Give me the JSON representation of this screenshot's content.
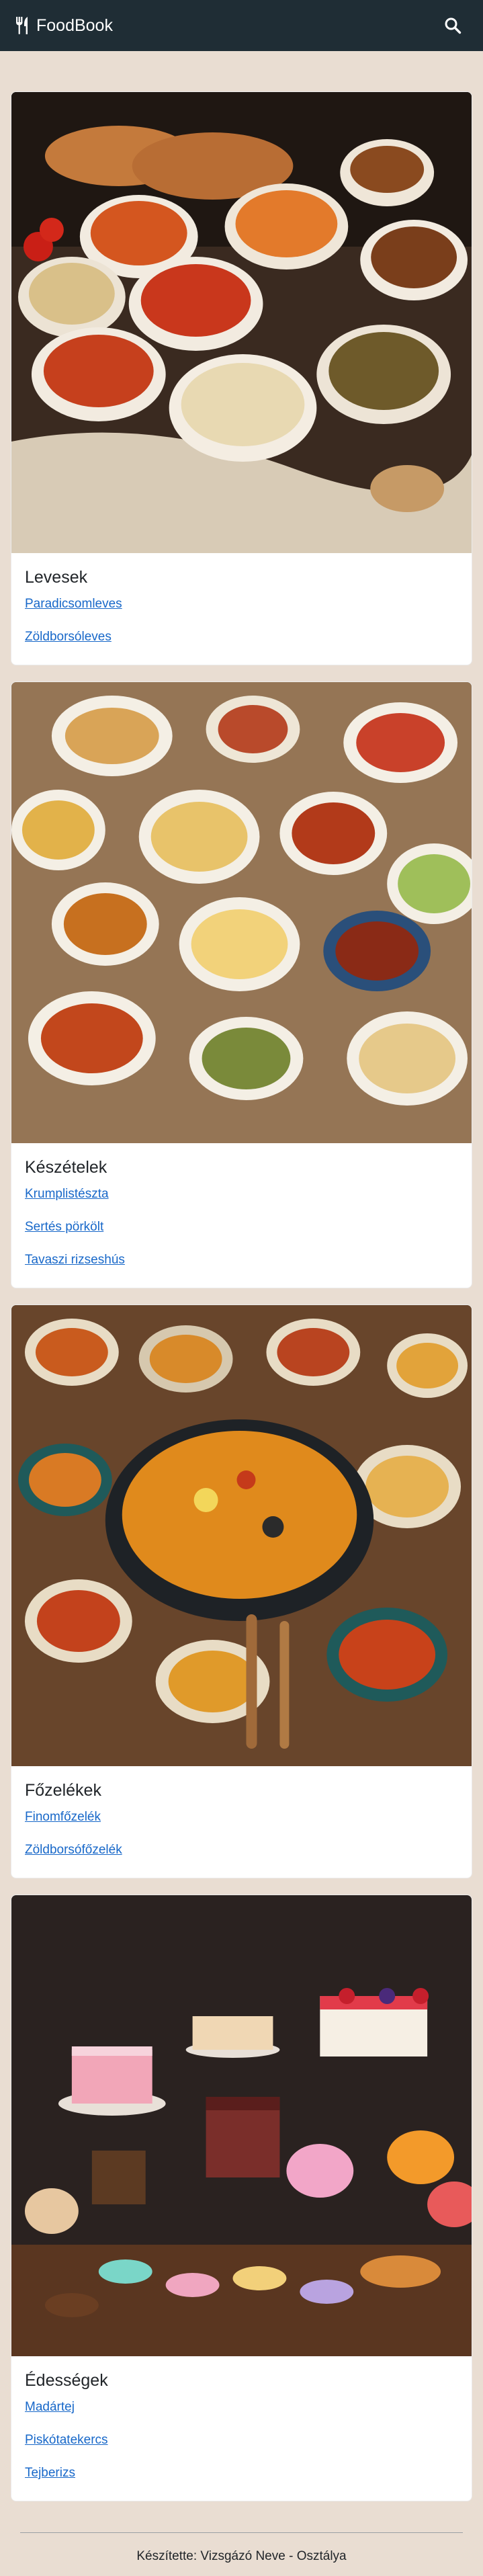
{
  "navbar": {
    "brand_icon": "utensils-icon",
    "brand_text": "FoodBook",
    "search_icon": "search-icon"
  },
  "categories": [
    {
      "title": "Levesek",
      "image": "soups-photo",
      "recipes": [
        "Paradicsomleves",
        "Zöldborsóleves"
      ]
    },
    {
      "title": "Készételek",
      "image": "main-dishes-photo",
      "recipes": [
        "Krumplistészta",
        "Sertés pörkölt",
        "Tavaszi rizseshús"
      ]
    },
    {
      "title": "Főzelékek",
      "image": "vegetable-stews-photo",
      "recipes": [
        "Finomfőzelék",
        "Zöldborsófőzelék"
      ]
    },
    {
      "title": "Édességek",
      "image": "desserts-photo",
      "recipes": [
        "Madártej",
        "Piskótatekercs",
        "Tejberizs"
      ]
    }
  ],
  "footer": {
    "text": "Készítette: Vizsgázó Neve - Osztálya"
  },
  "colors": {
    "navbar": "#1f2d35",
    "page_background": "#e9ddd2",
    "link": "#1868c9"
  }
}
